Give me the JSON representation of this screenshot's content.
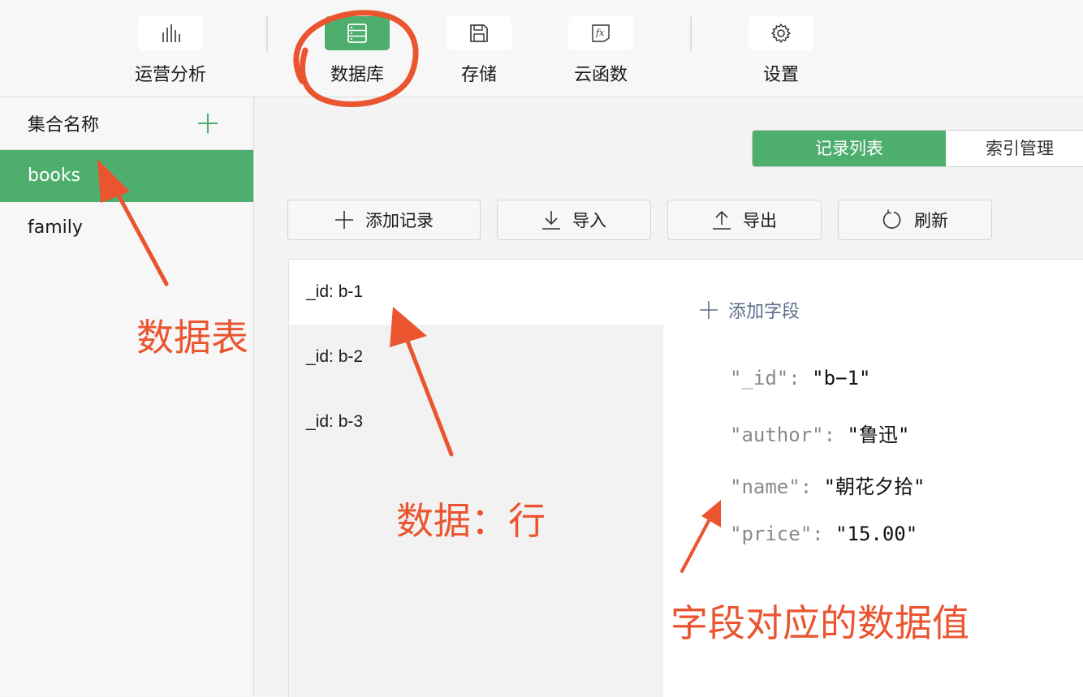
{
  "toolbar": {
    "items": [
      {
        "label": "运营分析",
        "icon": "bar-chart-icon"
      },
      {
        "label": "数据库",
        "icon": "database-icon",
        "active": true
      },
      {
        "label": "存储",
        "icon": "save-disk-icon"
      },
      {
        "label": "云函数",
        "icon": "function-fx-icon"
      },
      {
        "label": "设置",
        "icon": "gear-icon"
      }
    ]
  },
  "sidebar": {
    "title": "集合名称",
    "collections": [
      {
        "label": "books",
        "active": true
      },
      {
        "label": "family"
      }
    ]
  },
  "tabs": {
    "records": "记录列表",
    "index": "索引管理"
  },
  "actions": {
    "add_record": "添加记录",
    "import": "导入",
    "export": "导出",
    "refresh": "刷新"
  },
  "records": [
    {
      "label": "_id: b-1",
      "active": true
    },
    {
      "label": "_id: b-2"
    },
    {
      "label": "_id: b-3"
    }
  ],
  "detail": {
    "add_field": "添加字段",
    "fields": [
      {
        "key": "\"_id\"",
        "value": "\"b−1\""
      },
      {
        "key": "\"author\"",
        "value": "\"鲁迅\""
      },
      {
        "key": "\"name\"",
        "value": "\"朝花夕拾\""
      },
      {
        "key": "\"price\"",
        "value": "\"15.00\""
      }
    ]
  },
  "annotations": {
    "table": "数据表",
    "row": "数据：行",
    "field_value": "字段对应的数据值"
  },
  "colors": {
    "accent": "#4eae6e",
    "annotation": "#ea5530",
    "link": "#5b6e8c"
  }
}
